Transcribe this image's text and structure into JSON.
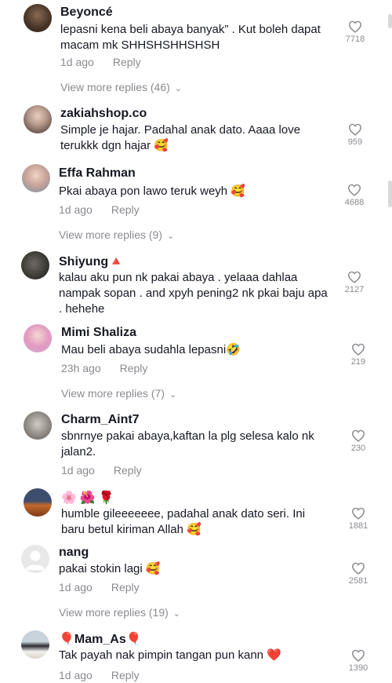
{
  "comments": [
    {
      "username": "Beyoncé",
      "text": "lepasni kena beli abaya banyak” . Kut boleh dapat macam mk SHHSHSHHSHSH",
      "time": "1d ago",
      "reply": "Reply",
      "likes": "7718",
      "view_more": "View more replies (46)"
    },
    {
      "username": "zakiahshop.co",
      "text": "Simple je hajar. Padahal anak dato. Aaaa love terukkk dgn hajar 🥰",
      "time": "",
      "reply": "",
      "likes": "959",
      "view_more": ""
    },
    {
      "username": "Effa Rahman",
      "text": "Pkai abaya pon lawo teruk weyh 🥰",
      "time": "1d ago",
      "reply": "Reply",
      "likes": "4688",
      "view_more": "View more replies (9)"
    },
    {
      "username": "Shiyung🔺",
      "text": "kalau aku pun nk pakai abaya . yelaaa dahlaa nampak sopan . and xpyh pening2 nk pkai baju apa . hehehe",
      "time": "",
      "reply": "",
      "likes": "2127",
      "view_more": ""
    },
    {
      "username": "Mimi Shaliza",
      "text": "Mau beli abaya sudahla lepasni🤣",
      "time": "23h ago",
      "reply": "Reply",
      "likes": "219",
      "view_more": "View more replies (7)"
    },
    {
      "username": "Charm_Aint7",
      "text": "sbnrnye pakai abaya,kaftan la plg selesa kalo nk jalan2.",
      "time": "1d ago",
      "reply": "Reply",
      "likes": "230",
      "view_more": ""
    },
    {
      "username": "🌸🌺🌹",
      "text": "humble gileeeeeee, padahal anak dato seri. Ini baru betul kiriman Allah 🥰",
      "time": "",
      "reply": "",
      "likes": "1881",
      "view_more": ""
    },
    {
      "username": "nang",
      "text": "pakai stokin lagi 🥰",
      "time": "1d ago",
      "reply": "Reply",
      "likes": "2581",
      "view_more": "View more replies (19)"
    },
    {
      "username": "🎈Mam_As🎈",
      "text": "Tak payah nak pimpin tangan pun kann ❤️",
      "time": "1d ago",
      "reply": "Reply",
      "likes": "1390",
      "view_more": ""
    }
  ],
  "icons": {
    "like": "heart-outline-icon",
    "chevron": "chevron-down-icon"
  },
  "colors": {
    "text": "#161823",
    "secondary": "#8a8b91"
  }
}
